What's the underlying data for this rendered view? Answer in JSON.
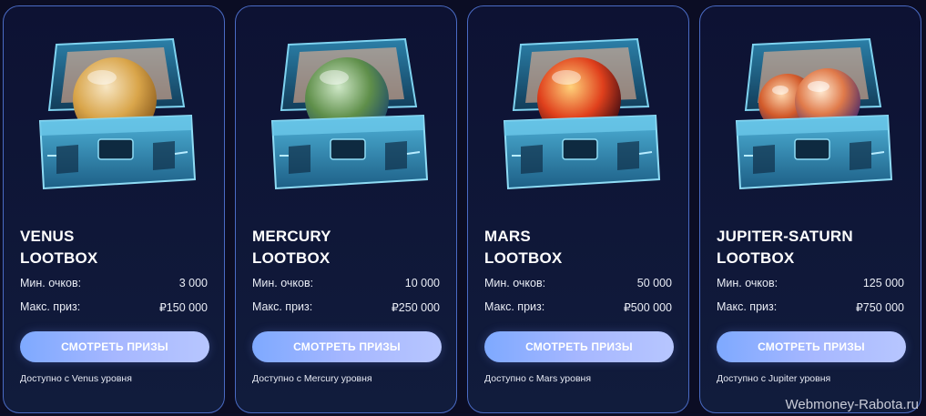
{
  "cards": [
    {
      "title_line1": "VENUS",
      "title_line2": "LOOTBOX",
      "min_label": "Мин. очков:",
      "min_value": "3 000",
      "max_label": "Макс. приз:",
      "max_value": "₽150 000",
      "button": "СМОТРЕТЬ ПРИЗЫ",
      "availability": "Доступно с Venus уровня",
      "orb_colors": [
        "#f7e6c4",
        "#d9a54a",
        "#8a5a1c"
      ]
    },
    {
      "title_line1": "MERCURY",
      "title_line2": "LOOTBOX",
      "min_label": "Мин. очков:",
      "min_value": "10 000",
      "max_label": "Макс. приз:",
      "max_value": "₽250 000",
      "button": "СМОТРЕТЬ ПРИЗЫ",
      "availability": "Доступно с Mercury уровня",
      "orb_colors": [
        "#cfe8c8",
        "#5f8f4a",
        "#1d4a6a"
      ]
    },
    {
      "title_line1": "MARS",
      "title_line2": "LOOTBOX",
      "min_label": "Мин. очков:",
      "min_value": "50 000",
      "max_label": "Макс. приз:",
      "max_value": "₽500 000",
      "button": "СМОТРЕТЬ ПРИЗЫ",
      "availability": "Доступно с Mars уровня",
      "orb_colors": [
        "#ffd27a",
        "#e0401c",
        "#3a0a12"
      ]
    },
    {
      "title_line1": "JUPITER-SATURN",
      "title_line2": "LOOTBOX",
      "min_label": "Мин. очков:",
      "min_value": "125 000",
      "max_label": "Макс. приз:",
      "max_value": "₽750 000",
      "button": "СМОТРЕТЬ ПРИЗЫ",
      "availability": "Доступно с Jupiter уровня",
      "orb_colors": [
        "#ffd9b0",
        "#d25a2a",
        "#3a2a5a"
      ]
    }
  ],
  "watermark": "Webmoney-Rabota.ru",
  "colors": {
    "background": "#0b0d24",
    "card_border": "#4a6bc4",
    "button_gradient_start": "#7ea9ff",
    "button_gradient_end": "#b7c6ff",
    "chest_metal": "#1d5f86",
    "chest_glow": "#ffb890"
  },
  "icons": [
    "lootbox-chest-icon",
    "planet-orb-icon"
  ]
}
